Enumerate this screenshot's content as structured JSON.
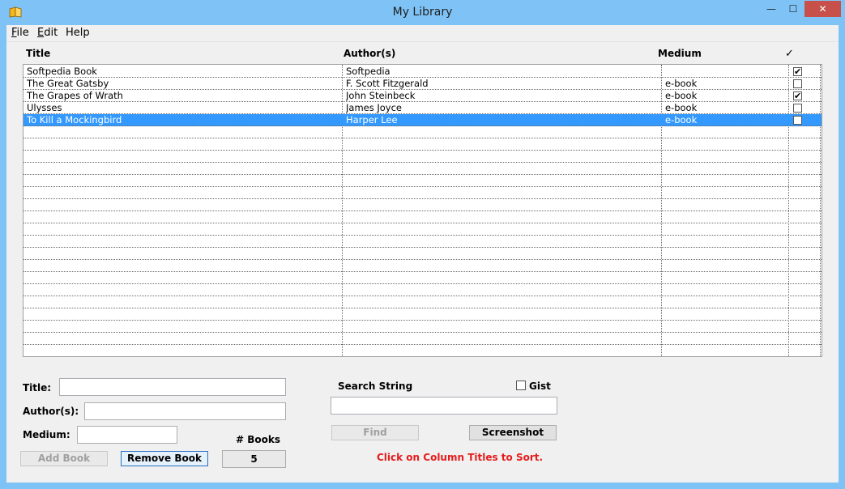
{
  "window": {
    "title": "My Library",
    "minimize_glyph": "—",
    "maximize_glyph": "☐",
    "close_glyph": "✕",
    "accent": "#7fc3f6",
    "close_color": "#c7504b"
  },
  "menu": {
    "file_first": "F",
    "file_rest": "ile",
    "edit_first": "E",
    "edit_rest": "dit",
    "help": "Help"
  },
  "table": {
    "columns": [
      "Title",
      "Author(s)",
      "Medium",
      "✓"
    ],
    "selected_color": "#3399ff",
    "rows": [
      {
        "title": "Softpedia Book",
        "author": "Softpedia",
        "medium": "",
        "checked": true
      },
      {
        "title": "The Great Gatsby",
        "author": "F. Scott Fitzgerald",
        "medium": "e-book",
        "checked": false
      },
      {
        "title": "The Grapes of Wrath",
        "author": "John Steinbeck",
        "medium": "e-book",
        "checked": true
      },
      {
        "title": "Ulysses",
        "author": "James Joyce",
        "medium": "e-book",
        "checked": false
      },
      {
        "title": "To Kill a Mockingbird",
        "author": "Harper Lee",
        "medium": "e-book",
        "checked": false,
        "selected": true
      }
    ],
    "empty_rows": 19
  },
  "form": {
    "title_label": "Title:",
    "title_value": "",
    "authors_label": "Author(s):",
    "authors_value": "",
    "medium_label": "Medium:",
    "medium_value": "",
    "books_label": "# Books",
    "books_count": "5",
    "add_button": "Add Book",
    "remove_button": "Remove Book"
  },
  "search": {
    "label": "Search String",
    "value": "",
    "gist_label": "Gist",
    "find_button": "Find",
    "screenshot_button": "Screenshot",
    "hint": "Click on Column Titles to Sort.",
    "hint_color": "#e51c1c"
  }
}
